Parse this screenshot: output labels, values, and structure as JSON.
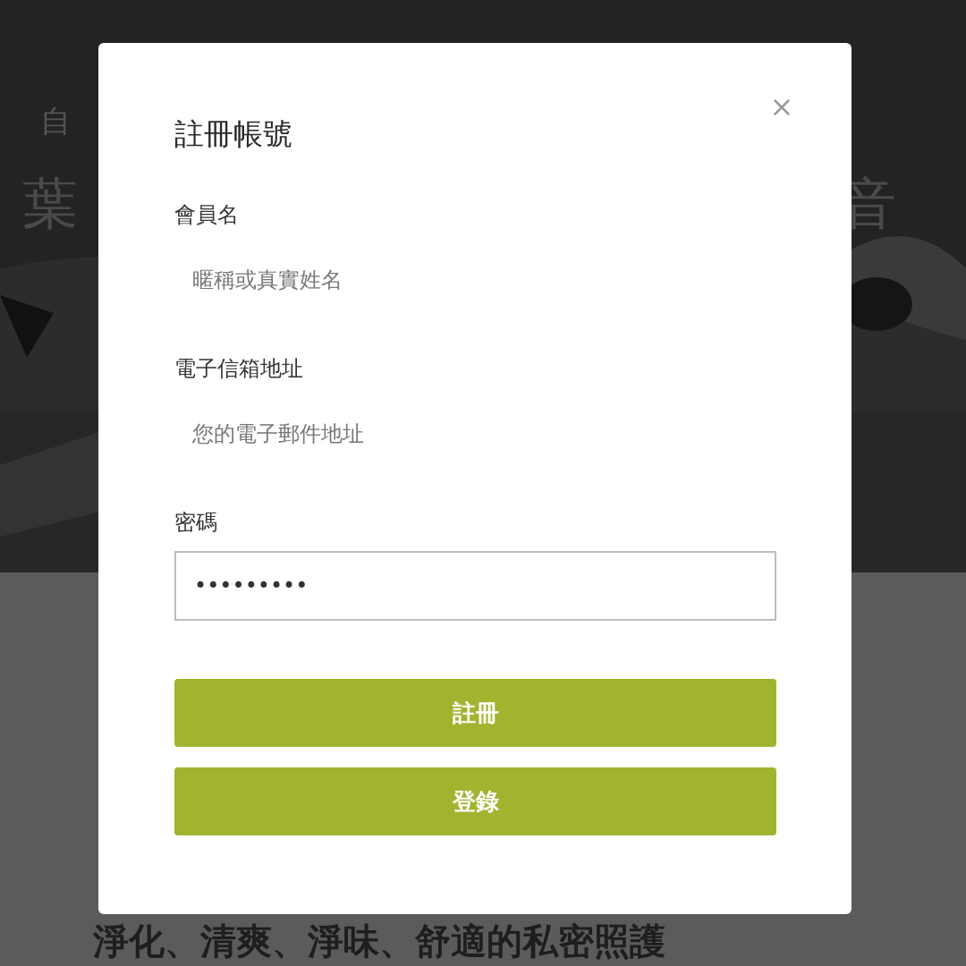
{
  "background": {
    "nav_text": "自",
    "heading_left": "葉",
    "heading_right": "音",
    "tagline": "淨化、清爽、淨味、舒適的私密照護"
  },
  "dialog": {
    "title": "註冊帳號",
    "fields": [
      {
        "kind": "plain",
        "label": "會員名",
        "placeholder": "暱稱或真實姓名"
      },
      {
        "kind": "plain",
        "label": "電子信箱地址",
        "placeholder": "您的電子郵件地址"
      },
      {
        "kind": "bordered",
        "label": "密碼",
        "value": "•••••••••"
      }
    ],
    "buttons": [
      "註冊",
      "登錄"
    ]
  }
}
